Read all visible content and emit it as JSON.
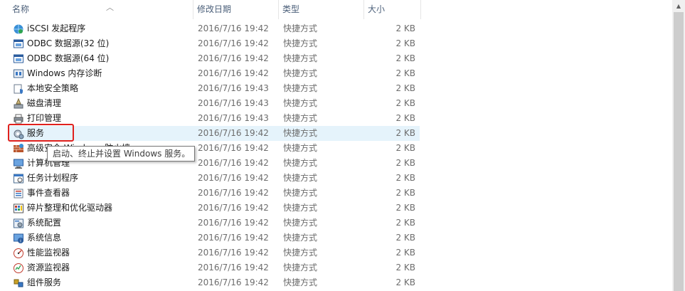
{
  "columns": {
    "name": "名称",
    "date": "修改日期",
    "type": "类型",
    "size": "大小"
  },
  "rows": [
    {
      "name": "iSCSI 发起程序",
      "date": "2016/7/16 19:42",
      "type": "快捷方式",
      "size": "2 KB",
      "icon": "iscsi-icon"
    },
    {
      "name": "ODBC 数据源(32 位)",
      "date": "2016/7/16 19:42",
      "type": "快捷方式",
      "size": "2 KB",
      "icon": "odbc-icon"
    },
    {
      "name": "ODBC 数据源(64 位)",
      "date": "2016/7/16 19:42",
      "type": "快捷方式",
      "size": "2 KB",
      "icon": "odbc-icon"
    },
    {
      "name": "Windows 内存诊断",
      "date": "2016/7/16 19:42",
      "type": "快捷方式",
      "size": "2 KB",
      "icon": "memory-diagnostic-icon"
    },
    {
      "name": "本地安全策略",
      "date": "2016/7/16 19:43",
      "type": "快捷方式",
      "size": "2 KB",
      "icon": "security-policy-icon"
    },
    {
      "name": "磁盘清理",
      "date": "2016/7/16 19:43",
      "type": "快捷方式",
      "size": "2 KB",
      "icon": "disk-cleanup-icon"
    },
    {
      "name": "打印管理",
      "date": "2016/7/16 19:43",
      "type": "快捷方式",
      "size": "2 KB",
      "icon": "printer-icon"
    },
    {
      "name": "服务",
      "date": "2016/7/16 19:42",
      "type": "快捷方式",
      "size": "2 KB",
      "icon": "services-gear-icon"
    },
    {
      "name": "高级安全 Windows 防火墙",
      "date": "2016/7/16 19:42",
      "type": "快捷方式",
      "size": "2 KB",
      "icon": "firewall-icon"
    },
    {
      "name": "计算机管理",
      "date": "2016/7/16 19:42",
      "type": "快捷方式",
      "size": "2 KB",
      "icon": "computer-management-icon"
    },
    {
      "name": "任务计划程序",
      "date": "2016/7/16 19:42",
      "type": "快捷方式",
      "size": "2 KB",
      "icon": "task-scheduler-icon"
    },
    {
      "name": "事件查看器",
      "date": "2016/7/16 19:42",
      "type": "快捷方式",
      "size": "2 KB",
      "icon": "event-viewer-icon"
    },
    {
      "name": "碎片整理和优化驱动器",
      "date": "2016/7/16 19:42",
      "type": "快捷方式",
      "size": "2 KB",
      "icon": "defrag-icon"
    },
    {
      "name": "系统配置",
      "date": "2016/7/16 19:42",
      "type": "快捷方式",
      "size": "2 KB",
      "icon": "system-config-icon"
    },
    {
      "name": "系统信息",
      "date": "2016/7/16 19:42",
      "type": "快捷方式",
      "size": "2 KB",
      "icon": "system-info-icon"
    },
    {
      "name": "性能监视器",
      "date": "2016/7/16 19:42",
      "type": "快捷方式",
      "size": "2 KB",
      "icon": "performance-monitor-icon"
    },
    {
      "name": "资源监视器",
      "date": "2016/7/16 19:42",
      "type": "快捷方式",
      "size": "2 KB",
      "icon": "resource-monitor-icon"
    },
    {
      "name": "组件服务",
      "date": "2016/7/16 19:42",
      "type": "快捷方式",
      "size": "2 KB",
      "icon": "component-services-icon"
    }
  ],
  "hover_row_index": 7,
  "tooltip": {
    "text": "启动、终止并设置 Windows 服务。"
  },
  "colors": {
    "header_text": "#4c607a",
    "hover_bg": "#e5f3fb",
    "highlight_border": "#e0211d",
    "secondary_text": "#6d6d6d"
  }
}
